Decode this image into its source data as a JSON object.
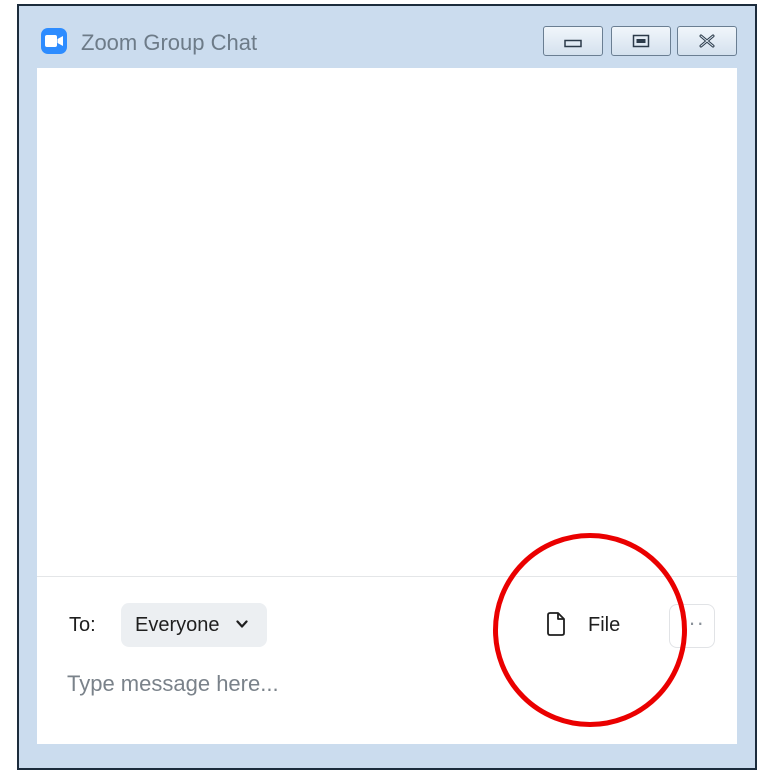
{
  "window": {
    "title": "Zoom Group Chat",
    "controls": [
      "minimize",
      "maximize",
      "close"
    ]
  },
  "icons": {
    "app": "zoom-camera-icon",
    "minimize": "minimize-icon",
    "maximize": "maximize-icon",
    "close": "close-icon",
    "file": "file-icon",
    "chevron": "chevron-down-icon",
    "more": "more-icon"
  },
  "composer": {
    "to_label": "To:",
    "recipient": "Everyone",
    "file_label": "File",
    "more_label": "···",
    "message_placeholder": "Type message here...",
    "message_value": ""
  },
  "colors": {
    "window_frame": "#cbdcee",
    "zoom_blue": "#2d8cff",
    "highlight_circle": "#ea0000"
  }
}
